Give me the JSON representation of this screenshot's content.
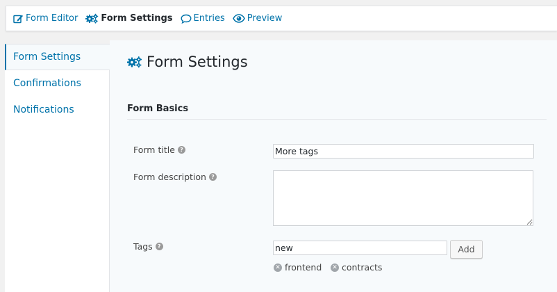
{
  "topnav": {
    "form_editor": "Form Editor",
    "form_settings": "Form Settings",
    "entries": "Entries",
    "preview": "Preview"
  },
  "sidebar": {
    "items": [
      {
        "label": "Form Settings",
        "active": true
      },
      {
        "label": "Confirmations",
        "active": false
      },
      {
        "label": "Notifications",
        "active": false
      }
    ]
  },
  "main": {
    "title": "Form Settings",
    "section": "Form Basics",
    "form_title": {
      "label": "Form title",
      "value": "More tags"
    },
    "form_description": {
      "label": "Form description",
      "value": ""
    },
    "tags": {
      "label": "Tags",
      "input_value": "new",
      "add_label": "Add",
      "items": [
        "frontend",
        "contracts"
      ]
    }
  },
  "icons": {
    "help": "?",
    "remove": "✕"
  },
  "colors": {
    "link": "#0073aa",
    "background": "#f1f1f1",
    "panel": "#f7fafc"
  }
}
